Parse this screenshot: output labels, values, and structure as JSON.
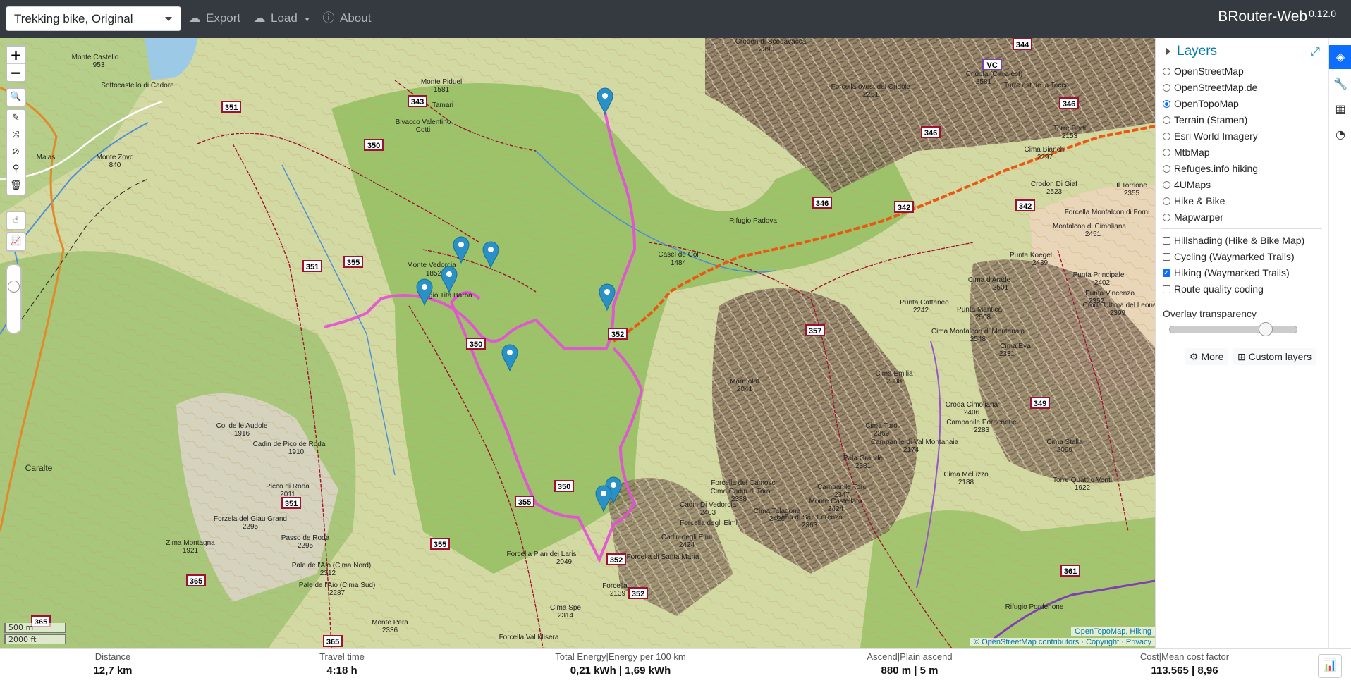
{
  "navbar": {
    "profile": "Trekking bike, Original",
    "export_label": "Export",
    "load_label": "Load",
    "about_label": "About",
    "brand": "BRouter-Web",
    "version": "0.12.0"
  },
  "map": {
    "zoom_in": "+",
    "zoom_out": "−",
    "scale_metric": "500 m",
    "scale_imperial": "2000 ft",
    "attribution_top": "OpenTopoMap, Hiking",
    "attribution_bottom": "© OpenStreetMap contributors · Copyright · Privacy",
    "labels": [
      {
        "t": "Monte Castello",
        "s": "953"
      },
      {
        "t": "Sottocastello di Cadore"
      },
      {
        "t": "Maias"
      },
      {
        "t": "Monte Zovo",
        "s": "840"
      },
      {
        "t": "Monte Piduel",
        "s": "1581"
      },
      {
        "t": "Bivacco Valentino",
        "s": "Cotti"
      },
      {
        "t": "Tamari"
      },
      {
        "t": "Monte Vedorcia"
      },
      {
        "t": "Rifugio Tita Barba"
      },
      {
        "t": "Rifugio Padova"
      },
      {
        "t": "Casel de Col",
        "s": "1484"
      },
      {
        "t": "Crodon di Scodavacca",
        "s": "2390"
      },
      {
        "t": "Forcella ovest del Cridola",
        "s": "2261"
      },
      {
        "t": "Cridola (Cima est)",
        "s": "2581"
      },
      {
        "t": "Torre est de la Tacca"
      },
      {
        "t": "Torre Berti",
        "s": "2153"
      },
      {
        "t": "Cima Bianchi",
        "s": "2297"
      },
      {
        "t": "Crodon Di Giaf",
        "s": "2523"
      },
      {
        "t": "Forcella Monfalcon di Forni"
      },
      {
        "t": "Monfalcon di Cimoliana",
        "s": "2451"
      },
      {
        "t": "Punta Koegel",
        "s": "2439"
      },
      {
        "t": "Cima d'Arade",
        "s": "2501"
      },
      {
        "t": "Punta Cattaneo",
        "s": "2242"
      },
      {
        "t": "Punta Mantica",
        "s": "2508"
      },
      {
        "t": "Cima Monfalcon di Montanaia",
        "s": "2548"
      },
      {
        "t": "Cima Eva",
        "s": "2331"
      },
      {
        "t": "Punta Principale",
        "s": "2402"
      },
      {
        "t": "Punta Vincenzo",
        "s": "2352"
      },
      {
        "t": "Croda Ultima del Leone",
        "s": "2399"
      },
      {
        "t": "Marmolat",
        "s": "2041"
      },
      {
        "t": "Cima Emilia",
        "s": "2388"
      },
      {
        "t": "Croda Cimoliana",
        "s": "2406"
      },
      {
        "t": "Campanile Pordenone",
        "s": "2283"
      },
      {
        "t": "Cima Toro",
        "s": "2369"
      },
      {
        "t": "Campanile di Val Montanaia",
        "s": "2174"
      },
      {
        "t": "Cima Stalla",
        "s": "2099"
      },
      {
        "t": "Pala Grande",
        "s": "2381"
      },
      {
        "t": "Cima Meluzzo",
        "s": "2188"
      },
      {
        "t": "Torre Quattro Venti",
        "s": "1922"
      },
      {
        "t": "Campanile Toro",
        "s": "2347"
      },
      {
        "t": "Monte Castellato",
        "s": "2424"
      },
      {
        "t": "Cima Talagona",
        "s": "2420"
      },
      {
        "t": "Cima di San Lorenzo",
        "s": "2363"
      },
      {
        "t": "Forcella dei Camosci"
      },
      {
        "t": "Cima Cadin di Toro",
        "s": "2388"
      },
      {
        "t": "Cadin Di Vedorcia",
        "s": "2403"
      },
      {
        "t": "Forcella degli Elmi"
      },
      {
        "t": "Cadin degli Elmi",
        "s": "2424"
      },
      {
        "t": "Forcella di Santa Maria"
      },
      {
        "t": "Forcella Pian dei Laris"
      },
      {
        "t": "Forcella",
        "s": "2139"
      },
      {
        "t": "Cima Spe",
        "s": "2314"
      },
      {
        "t": "Forcella Val Misera"
      },
      {
        "t": "Col de le Audole",
        "s": "1916"
      },
      {
        "t": "Cadin de Pico de Roda",
        "s": "1910"
      },
      {
        "t": "Caralte"
      },
      {
        "t": "Picco di Roda",
        "s": "2011"
      },
      {
        "t": "Forzela del Giau Grand",
        "s": "2295"
      },
      {
        "t": "Passo de Roda",
        "s": "2295"
      },
      {
        "t": "Zima Montagna",
        "s": "1921"
      },
      {
        "t": "Pale de l'Aio (Cima Nord)",
        "s": "2312"
      },
      {
        "t": "Pale de l'Aio (Cima Sud)",
        "s": "2287"
      },
      {
        "t": "Monte Pera",
        "s": "2336"
      },
      {
        "t": "Rifugio Pordenone"
      },
      {
        "t": "Il Torrione",
        "s": "2355"
      }
    ],
    "trail_numbers": [
      "344",
      "VC",
      "343",
      "346",
      "346",
      "346",
      "351",
      "350",
      "342",
      "342",
      "351",
      "355",
      "357",
      "352",
      "350",
      "349",
      "355",
      "350",
      "355",
      "351",
      "352",
      "352",
      "361",
      "365",
      "365",
      "365"
    ]
  },
  "sidebar": {
    "title": "Layers",
    "base_layers": [
      {
        "label": "OpenStreetMap",
        "checked": false
      },
      {
        "label": "OpenStreetMap.de",
        "checked": false
      },
      {
        "label": "OpenTopoMap",
        "checked": true
      },
      {
        "label": "Terrain (Stamen)",
        "checked": false
      },
      {
        "label": "Esri World Imagery",
        "checked": false
      },
      {
        "label": "MtbMap",
        "checked": false
      },
      {
        "label": "Refuges.info hiking",
        "checked": false
      },
      {
        "label": "4UMaps",
        "checked": false
      },
      {
        "label": "Hike & Bike",
        "checked": false
      },
      {
        "label": "Mapwarper",
        "checked": false
      }
    ],
    "overlays": [
      {
        "label": "Hillshading (Hike & Bike Map)",
        "checked": false
      },
      {
        "label": "Cycling (Waymarked Trails)",
        "checked": false
      },
      {
        "label": "Hiking (Waymarked Trails)",
        "checked": true
      },
      {
        "label": "Route quality coding",
        "checked": false
      }
    ],
    "transparency_label": "Overlay transparency",
    "transparency_value": 0.75,
    "more_label": "More",
    "custom_layers_label": "Custom layers"
  },
  "stats": {
    "distance": {
      "label": "Distance",
      "value": "12,7 km"
    },
    "travel_time": {
      "label": "Travel time",
      "value": "4:18 h"
    },
    "energy": {
      "label": "Total Energy|Energy per 100 km",
      "value": "0,21 kWh | 1,69 kWh"
    },
    "ascend": {
      "label": "Ascend|Plain ascend",
      "value": "880 m | 5 m"
    },
    "cost": {
      "label": "Cost|Mean cost factor",
      "value": "113.565 | 8,96"
    }
  },
  "colors": {
    "navbar": "#343a40",
    "route": "#e64ed8",
    "accent": "#0d6efd",
    "trail": "#a01030"
  }
}
